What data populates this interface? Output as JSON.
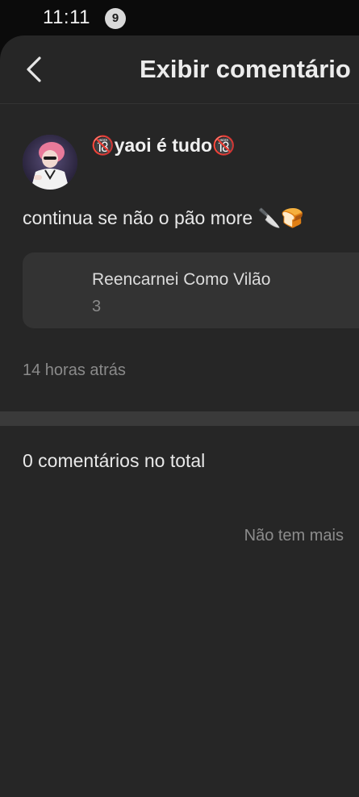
{
  "status_bar": {
    "time": "11:11",
    "notification_count": "9"
  },
  "header": {
    "title": "Exibir comentário",
    "back_icon": "chevron-left-icon"
  },
  "post": {
    "username": "🔞yaoi é tudo🔞",
    "text": "continua se não o pão more 🔪🍞",
    "work": {
      "title": "Reencarnei Como Vilão",
      "chapter": "3"
    },
    "time_ago": "14 horas atrás"
  },
  "comments": {
    "total_label": "0 comentários no total",
    "end_label": "Não tem mais"
  },
  "colors": {
    "background": "#262626",
    "card": "#333333",
    "muted_text": "#8a8a8a"
  }
}
